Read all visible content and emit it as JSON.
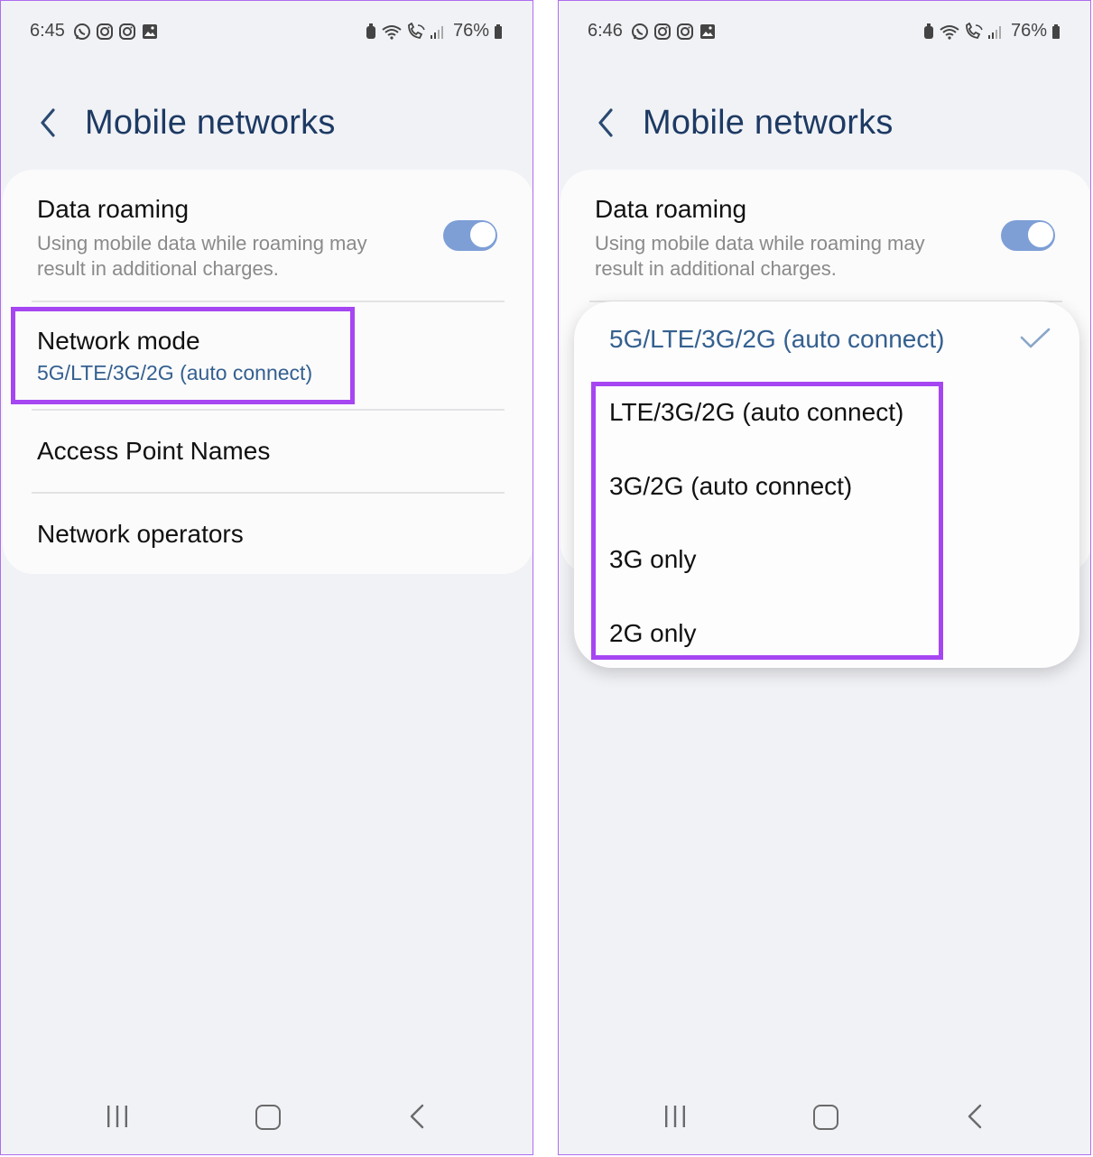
{
  "left": {
    "status": {
      "time": "6:45",
      "battery": "76%"
    },
    "header": {
      "title": "Mobile networks"
    },
    "rows": {
      "data_roaming": {
        "title": "Data roaming",
        "subtitle_line1": "Using mobile data while roaming may",
        "subtitle_line2": "result in additional charges.",
        "toggle_on": true
      },
      "network_mode": {
        "title": "Network mode",
        "value": "5G/LTE/3G/2G (auto connect)"
      },
      "apn": {
        "title": "Access Point Names"
      },
      "operators": {
        "title": "Network operators"
      }
    }
  },
  "right": {
    "status": {
      "time": "6:46",
      "battery": "76%"
    },
    "header": {
      "title": "Mobile networks"
    },
    "rows": {
      "data_roaming": {
        "title": "Data roaming",
        "subtitle_line1": "Using mobile data while roaming may",
        "subtitle_line2": "result in additional charges.",
        "toggle_on": true
      }
    },
    "popup": {
      "selected": "5G/LTE/3G/2G (auto connect)",
      "options": [
        "LTE/3G/2G (auto connect)",
        "3G/2G (auto connect)",
        "3G only",
        "2G only"
      ]
    }
  },
  "colors": {
    "highlight": "#a646f2",
    "title": "#1d3a63",
    "accent_text": "#35608f",
    "toggle": "#7e9fd6"
  },
  "icons": {
    "notifications": [
      "whatsapp-icon",
      "instagram-icon",
      "instagram-icon",
      "gallery-icon"
    ],
    "status_right": [
      "alarm-icon",
      "wifi-icon",
      "wifi-calling-icon",
      "signal-icon",
      "battery-icon"
    ],
    "nav": [
      "recents-icon",
      "home-icon",
      "back-icon"
    ]
  }
}
